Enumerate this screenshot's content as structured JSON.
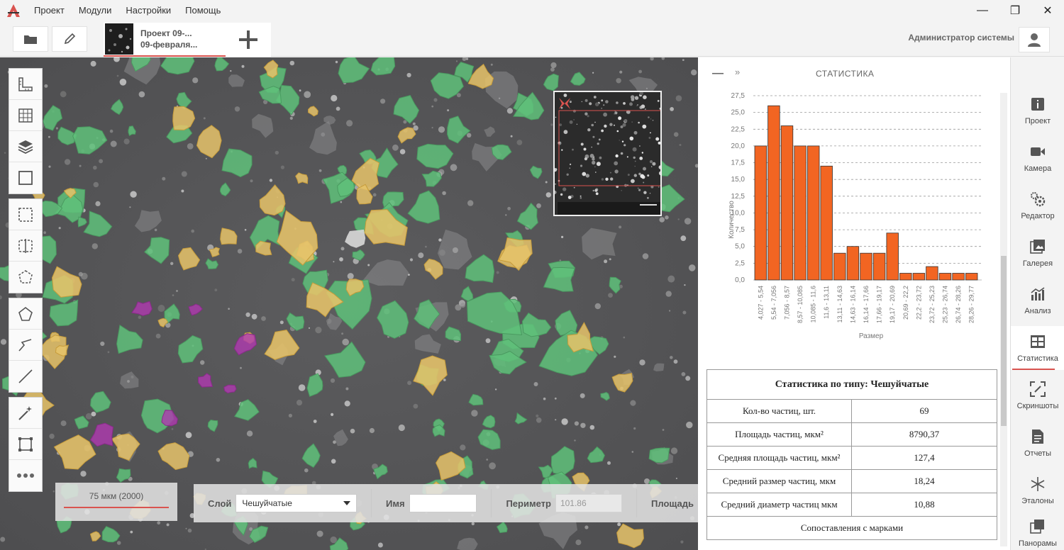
{
  "menu": {
    "items": [
      "Проект",
      "Модули",
      "Настройки",
      "Помощь"
    ]
  },
  "window": {
    "minimize": "—",
    "maximize": "❐",
    "close": "✕"
  },
  "toolbar": {
    "project_tab_line1": "Проект 09-...",
    "project_tab_line2": "09-февраля...",
    "user_name": "Администратор системы"
  },
  "scale": {
    "label": "75 мкм (2000)"
  },
  "properties": {
    "layer_label": "Слой",
    "layer_value": "Чешуйчатые",
    "name_label": "Имя",
    "name_value": "",
    "perimeter_label": "Периметр",
    "perimeter_value": "101.86",
    "area_label": "Площадь"
  },
  "stats": {
    "title": "СТАТИСТИКА",
    "collapse": "—",
    "expand": "»",
    "table_title": "Статистика по типу: Чешуйчатые",
    "rows": [
      {
        "label": "Кол-во частиц, шт.",
        "value": "69"
      },
      {
        "label": "Площадь частиц, мкм²",
        "value": "8790,37"
      },
      {
        "label": "Средняя площадь частиц, мкм²",
        "value": "127,4"
      },
      {
        "label": "Средний размер частиц, мкм",
        "value": "18,24"
      },
      {
        "label": "Средний диаметр частиц мкм",
        "value": "10,88"
      }
    ],
    "footer_row": "Сопоставления с марками"
  },
  "chart_data": {
    "type": "bar",
    "xlabel": "Размер",
    "ylabel": "Количество",
    "ylim": [
      0,
      27.5
    ],
    "yticks": [
      "0,0",
      "2,5",
      "5,0",
      "7,5",
      "10,0",
      "12,5",
      "15,0",
      "17,5",
      "20,0",
      "22,5",
      "25,0",
      "27,5"
    ],
    "grid": true,
    "bar_color": "#f26522",
    "categories": [
      "4,027 - 5,54",
      "5,54 - 7,056",
      "7,056 - 8,57",
      "8,57 - 10,085",
      "10,085 - 11,6",
      "11,6 - 13,11",
      "13,11 - 14,63",
      "14,63 - 16,14",
      "16,14 - 17,66",
      "17,66 - 19,17",
      "19,17 - 20,69",
      "20,69 - 22,2",
      "22,2 - 23,72",
      "23,72 - 25,23",
      "25,23 - 26,74",
      "26,74 - 28,26",
      "28,26 - 29,77"
    ],
    "values": [
      20,
      26,
      23,
      20,
      20,
      17,
      4,
      5,
      4,
      4,
      7,
      1,
      1,
      2,
      1,
      1,
      1
    ]
  },
  "nav": {
    "items": [
      {
        "label": "Проект",
        "icon": "info-icon"
      },
      {
        "label": "Камера",
        "icon": "camera-icon"
      },
      {
        "label": "Редактор",
        "icon": "editor-gears-icon"
      },
      {
        "label": "Галерея",
        "icon": "gallery-icon"
      },
      {
        "label": "Анализ",
        "icon": "analysis-chart-icon"
      },
      {
        "label": "Статистика",
        "icon": "statistics-table-icon"
      },
      {
        "label": "Скриншоты",
        "icon": "screenshot-icon"
      },
      {
        "label": "Отчеты",
        "icon": "report-icon"
      },
      {
        "label": "Эталоны",
        "icon": "standards-asterisk-icon"
      },
      {
        "label": "Панорамы",
        "icon": "panorama-icon"
      }
    ],
    "active_index": 5
  },
  "colors": {
    "accent": "#d9534f",
    "bar": "#f26522",
    "particle_green": "#5fc17a",
    "particle_yellow": "#e6c36a",
    "particle_magenta": "#b03ab0"
  }
}
